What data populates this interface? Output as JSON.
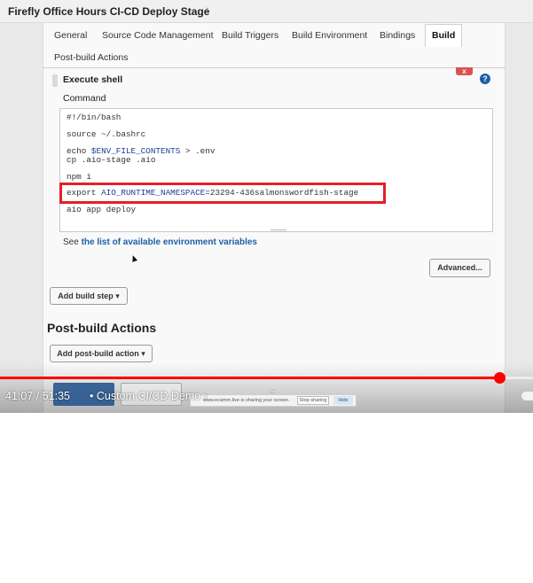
{
  "breadcrumb": {
    "title": "Firefly Office Hours CI-CD Deploy Stage",
    "separator": "›"
  },
  "tabs": [
    {
      "label": "General"
    },
    {
      "label": "Source Code Management"
    },
    {
      "label": "Build Triggers"
    },
    {
      "label": "Build Environment"
    },
    {
      "label": "Bindings"
    },
    {
      "label": "Build"
    },
    {
      "label": "Post-build Actions"
    }
  ],
  "build_step": {
    "title": "Execute shell",
    "close_glyph": "x",
    "help_glyph": "?",
    "command_label": "Command",
    "code": {
      "shebang": "#!/bin/bash",
      "source": "source ~/.bashrc",
      "echo_prefix": "echo ",
      "echo_var": "$ENV_FILE_CONTENTS",
      "echo_suffix": " > .env",
      "cp": "cp .aio-stage .aio",
      "npm": "npm i",
      "export_prefix": "export ",
      "export_var": "AIO_RUNTIME_NAMESPACE",
      "export_value": "=23294-436salmonswordfish-stage",
      "deploy": "aio app deploy"
    },
    "env_prefix": "See ",
    "env_link": "the list of available environment variables",
    "advanced_label": "Advanced..."
  },
  "add_build_step_label": "Add build step ▾",
  "post_build": {
    "heading": "Post-build Actions",
    "add_label": "Add post-build action ▾"
  },
  "screen_share": {
    "text": "www.ecamm.live is sharing your screen.",
    "stop_label": "Stop sharing",
    "hide_label": "Hide"
  },
  "player": {
    "time": "41:07 / 51:35",
    "separator": "•",
    "chapter": "Custom CI/CD Demo ›",
    "chevron": "⌄",
    "progress": 0.937,
    "buffered": 0.637
  },
  "colors": {
    "highlight": "#e2202a",
    "progress": "#ff0000",
    "link": "#1d5fa5",
    "close": "#d9534f"
  }
}
